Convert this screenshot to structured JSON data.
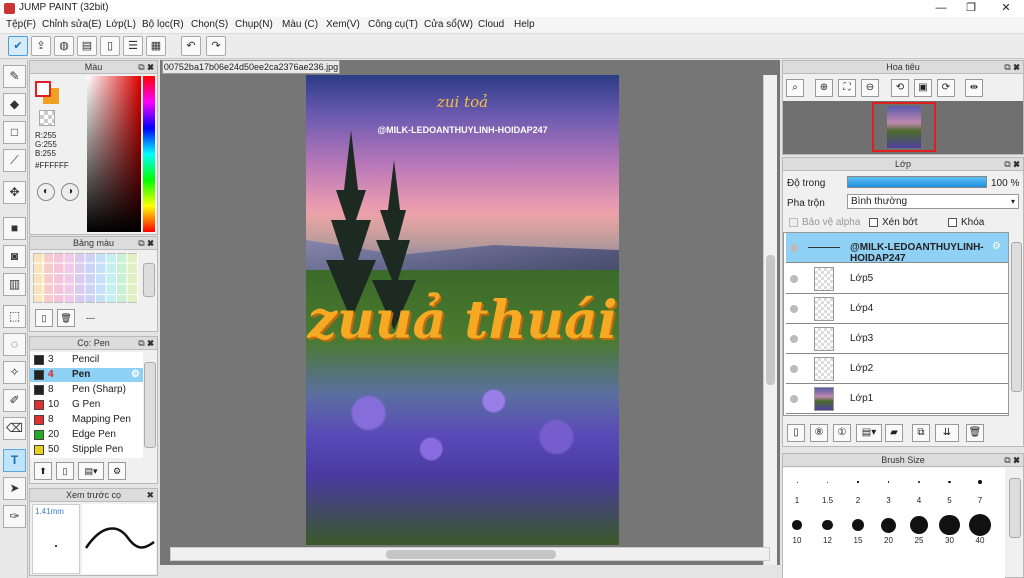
{
  "app": {
    "title": "JUMP PAINT (32bit)"
  },
  "window": {
    "minimize": "—",
    "maximize": "❐",
    "close": "✕"
  },
  "menu": [
    "Tệp(F)",
    "Chỉnh sửa(E)",
    "Lớp(L)",
    "Bộ lọc(R)",
    "Chọn(S)",
    "Chụp(N)",
    "Màu (C)",
    "Xem(V)",
    "Công cụ(T)",
    "Cửa sổ(W)",
    "Cloud",
    "Help"
  ],
  "doc": {
    "filename": "00752ba17b06e24d50ee2ca2376ae236.jpg"
  },
  "photo": {
    "small_text": "zui toả",
    "handle": "@MILK-LEDOANTHUYLINH-HOIDAP247",
    "big_text": "zuuả thuái"
  },
  "color_panel": {
    "title": "Màu",
    "r": "R:255",
    "g": "G:255",
    "b": "B:255",
    "hex": "#FFFFFF"
  },
  "palette_panel": {
    "title": "Bảng màu",
    "dash": "---"
  },
  "brush_panel": {
    "title": "Cọ: Pen",
    "items": [
      {
        "size": "3",
        "name": "Pencil",
        "color": "#222222"
      },
      {
        "size": "4",
        "name": "Pen",
        "color": "#222222",
        "selected": true
      },
      {
        "size": "8",
        "name": "Pen (Sharp)",
        "color": "#222222"
      },
      {
        "size": "10",
        "name": "G Pen",
        "color": "#e03030"
      },
      {
        "size": "8",
        "name": "Mapping Pen",
        "color": "#e03030"
      },
      {
        "size": "20",
        "name": "Edge Pen",
        "color": "#22aa22"
      },
      {
        "size": "50",
        "name": "Stipple Pen",
        "color": "#e8d020"
      }
    ]
  },
  "preview_panel": {
    "title": "Xem trước cọ",
    "size": "1.41mm"
  },
  "navigator_panel": {
    "title": "Hoa tiêu"
  },
  "layer_panel": {
    "title": "Lớp",
    "opacity_label": "Độ trong",
    "opacity_value": "100 %",
    "opacity": 1.0,
    "blend_label": "Pha trộn",
    "blend_value": "Bình thường",
    "protect_alpha": "Bảo vệ alpha",
    "clip": "Xén bớt",
    "lock": "Khóa",
    "layers": [
      "@MILK-LEDOANTHUYLINH-HOIDAP247",
      "Lớp5",
      "Lớp4",
      "Lớp3",
      "Lớp2",
      "Lớp1"
    ]
  },
  "brush_size_panel": {
    "title": "Brush Size",
    "sizes": [
      "1",
      "1.5",
      "2",
      "3",
      "4",
      "5",
      "7",
      "10",
      "12",
      "15",
      "20",
      "25",
      "30",
      "40"
    ]
  },
  "colors": {
    "accent": "#3aa0e8",
    "selected_layer": "#8fd0f5",
    "fg": "#ffffff",
    "bg": "#f0a020"
  }
}
